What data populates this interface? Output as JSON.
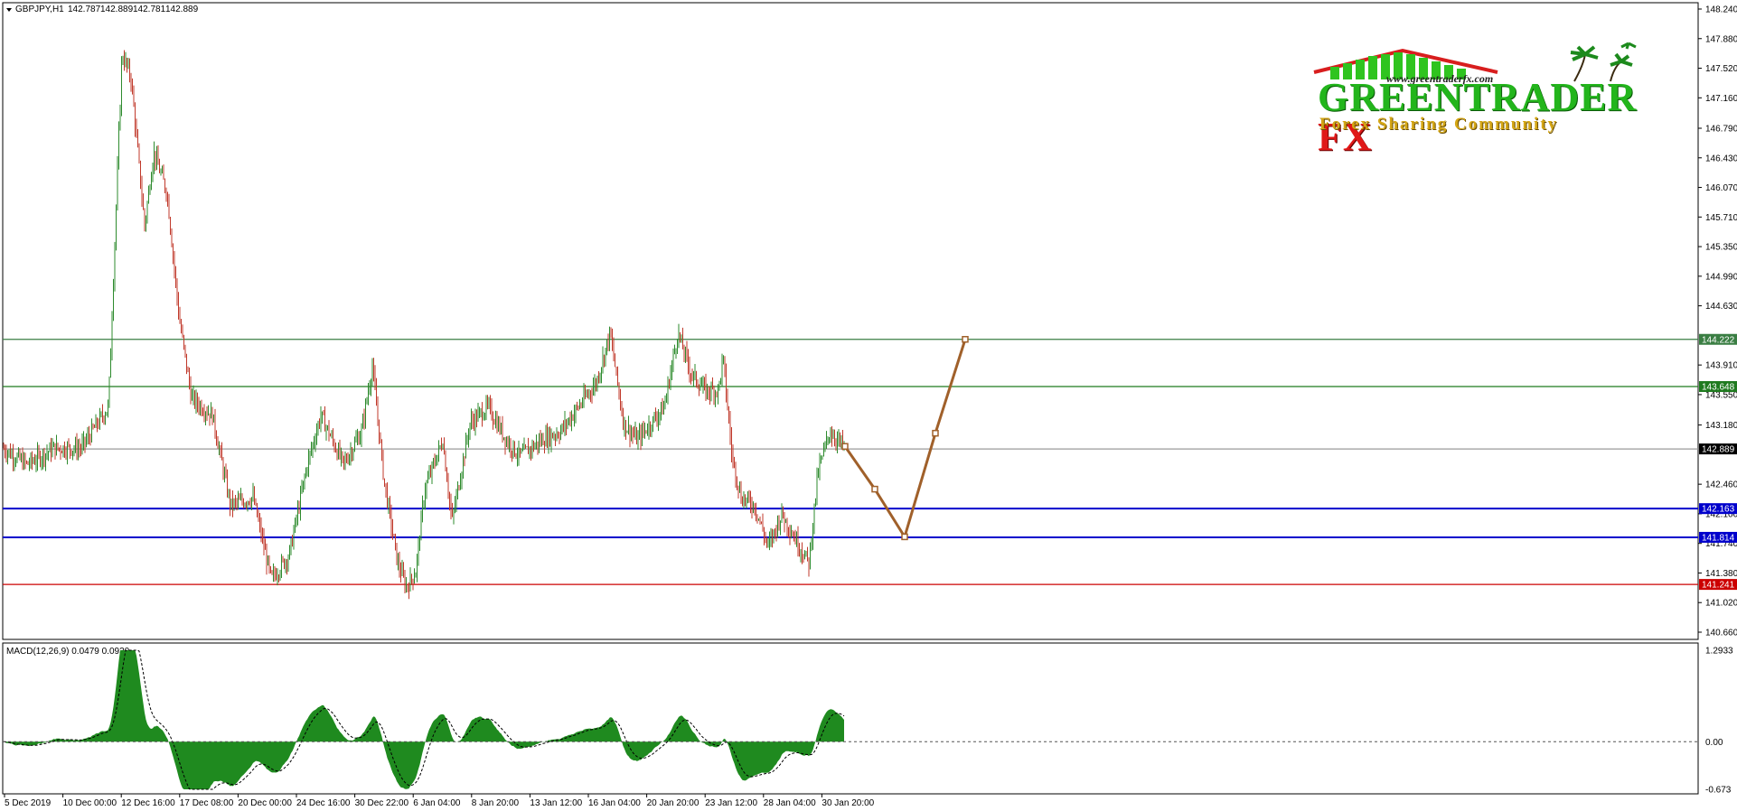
{
  "main": {
    "header": {
      "symbol": "GBPJPY,H1",
      "open": "142.787",
      "high": "142.889",
      "low": "142.781",
      "close": "142.889"
    },
    "y_min": 140.66,
    "y_max": 148.24,
    "price_ticks": [
      "148.240",
      "147.880",
      "147.520",
      "147.160",
      "146.790",
      "146.430",
      "146.070",
      "145.710",
      "145.350",
      "144.990",
      "144.630",
      "143.910",
      "143.550",
      "143.180",
      "142.460",
      "142.100",
      "141.740",
      "141.380",
      "141.020",
      "140.660"
    ],
    "levels": [
      {
        "label": "144.222",
        "value": 144.222,
        "color": "#3a7e43"
      },
      {
        "label": "143.648",
        "value": 143.648,
        "color": "#1f7a1f"
      },
      {
        "label": "142.889",
        "value": 142.889,
        "color": "#000000"
      },
      {
        "label": "142.163",
        "value": 142.163,
        "color": "#0000cc"
      },
      {
        "label": "141.814",
        "value": 141.814,
        "color": "#0000cc"
      },
      {
        "label": "141.241",
        "value": 141.241,
        "color": "#cc0000"
      }
    ],
    "projection": [
      {
        "x": 0.0,
        "y": 142.92
      },
      {
        "x": 0.33,
        "y": 142.4
      },
      {
        "x": 0.66,
        "y": 141.82
      },
      {
        "x": 1.0,
        "y": 143.08
      },
      {
        "x": 1.33,
        "y": 144.222
      }
    ]
  },
  "macd": {
    "label": "MACD(12,26,9) 0.0479 0.0930",
    "y_min": -0.673,
    "y_max": 1.2933,
    "ticks": [
      "1.2933",
      "0.00",
      "-0.673"
    ],
    "histogram_color": "#1f8a1f",
    "signal_color": "#000000"
  },
  "time_axis": [
    "5 Dec 2019",
    "10 Dec 00:00",
    "12 Dec 16:00",
    "17 Dec 08:00",
    "20 Dec 00:00",
    "24 Dec 16:00",
    "30 Dec 22:00",
    "6 Jan 04:00",
    "8 Jan 20:00",
    "13 Jan 12:00",
    "16 Jan 04:00",
    "20 Jan 20:00",
    "23 Jan 12:00",
    "28 Jan 04:00",
    "30 Jan 20:00"
  ],
  "logo": {
    "url": "www.greentraderfx.com",
    "main": "GREENTRADER",
    "fx": "FX",
    "sub": "Forex Sharing Community"
  },
  "colors": {
    "bull": "#2e8b2e",
    "bear": "#c0392b",
    "projection": "#a0602a"
  }
}
